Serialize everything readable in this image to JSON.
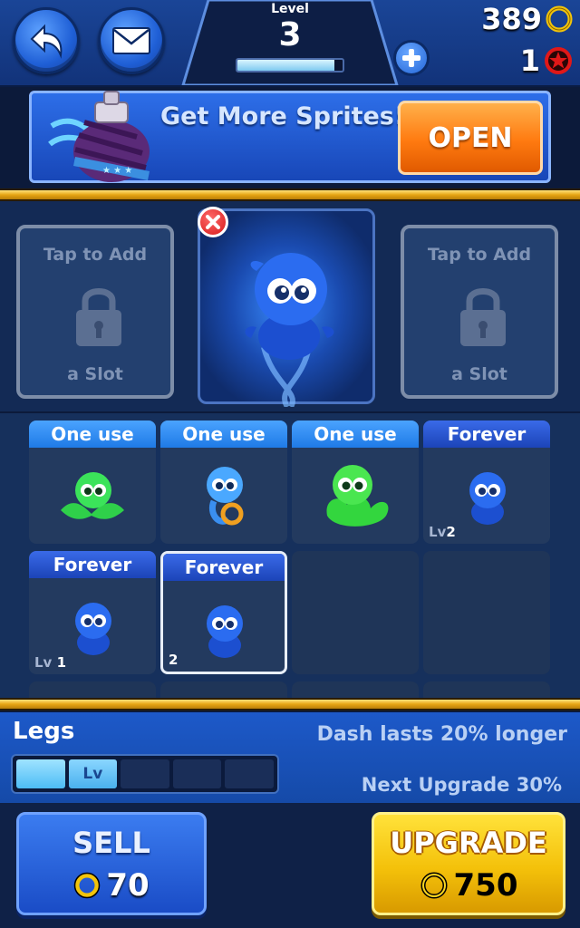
{
  "header": {
    "level_label": "Level",
    "level_value": "3",
    "xp_progress": 0.92,
    "coins": "389",
    "gems": "1",
    "icons": {
      "back": "back-arrow-icon",
      "mail": "mail-icon",
      "add": "plus-icon",
      "coin": "coin-icon",
      "gem": "star-gem-icon"
    }
  },
  "banner": {
    "text": "Get More Sprites!",
    "button_label": "OPEN",
    "icon": "sprite-potion-icon"
  },
  "slots": {
    "left": {
      "top_text": "Tap to Add",
      "bottom_text": "a Slot"
    },
    "right": {
      "top_text": "Tap to Add",
      "bottom_text": "a Slot"
    },
    "active": {
      "sprite": "blue-sprite",
      "remove_icon": "close-icon"
    }
  },
  "inventory": {
    "cards": [
      {
        "label": "One use",
        "sprite": "green-leaf-sprite"
      },
      {
        "label": "One use",
        "sprite": "blue-ring-sprite"
      },
      {
        "label": "One use",
        "sprite": "green-blob-sprite"
      },
      {
        "label": "Forever",
        "sprite": "blue-sprite",
        "level_prefix": "Lv",
        "level": "2"
      },
      {
        "label": "Forever",
        "sprite": "blue-sprite",
        "level_prefix": "Lv",
        "level": "1"
      },
      {
        "label": "Forever",
        "sprite": "blue-sprite",
        "level": "2",
        "selected": true
      }
    ]
  },
  "details": {
    "part_name": "Legs",
    "description": "Dash lasts 20% longer",
    "level_bar_label": "Lv",
    "level_segments_filled": 2,
    "level_segments_total": 5,
    "next_upgrade": "Next Upgrade 30%"
  },
  "actions": {
    "sell_label": "SELL",
    "sell_price": "70",
    "upgrade_label": "UPGRADE",
    "upgrade_price": "750"
  },
  "colors": {
    "accent_gold": "#f4c10a",
    "button_blue": "#1f5fd6",
    "open_orange": "#ff7a10"
  }
}
